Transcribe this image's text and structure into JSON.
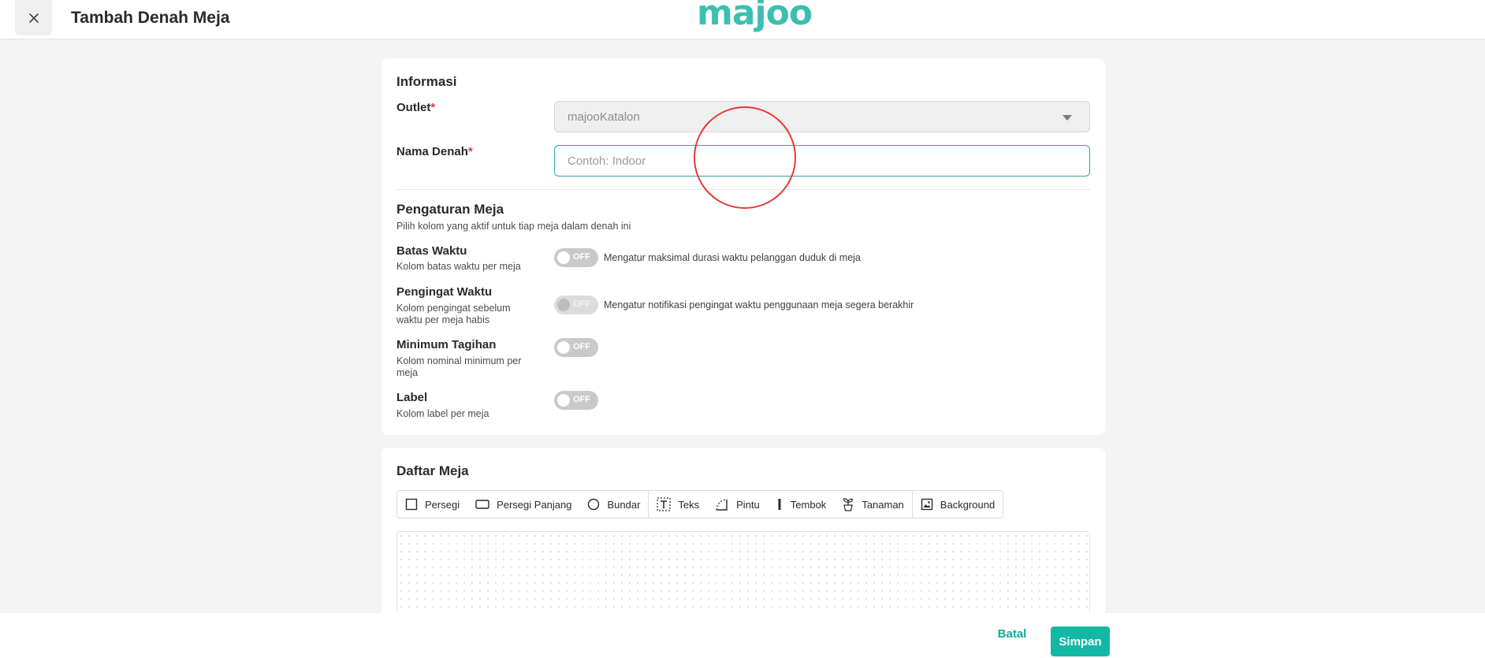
{
  "header": {
    "title": "Tambah Denah Meja",
    "logo": "majoo",
    "close_icon": "close-icon"
  },
  "informasi": {
    "title": "Informasi",
    "outlet_label": "Outlet",
    "outlet_value": "majooKatalon",
    "nama_label": "Nama Denah",
    "nama_placeholder": "Contoh: Indoor",
    "nama_value": "",
    "required_mark": "*"
  },
  "pengaturan": {
    "title": "Pengaturan Meja",
    "subtitle": "Pilih kolom yang aktif untuk tiap meja dalam denah ini",
    "rows": [
      {
        "title": "Batas Waktu",
        "desc": "Kolom batas waktu per meja",
        "toggle": "OFF",
        "toggle_desc": "Mengatur maksimal durasi waktu pelanggan duduk di meja",
        "disabled": false
      },
      {
        "title": "Pengingat Waktu",
        "desc": "Kolom pengingat sebelum waktu per meja habis",
        "toggle": "OFF",
        "toggle_desc": "Mengatur notifikasi pengingat waktu penggunaan meja segera berakhir",
        "disabled": true
      },
      {
        "title": "Minimum Tagihan",
        "desc": "Kolom nominal minimum per meja",
        "toggle": "OFF",
        "toggle_desc": "",
        "disabled": false
      },
      {
        "title": "Label",
        "desc": "Kolom label per meja",
        "toggle": "OFF",
        "toggle_desc": "",
        "disabled": false
      }
    ]
  },
  "daftar": {
    "title": "Daftar Meja",
    "tools": [
      {
        "label": "Persegi",
        "icon": "square-icon"
      },
      {
        "label": "Persegi Panjang",
        "icon": "rectangle-icon"
      },
      {
        "label": "Bundar",
        "icon": "circle-icon"
      },
      {
        "label": "Teks",
        "icon": "text-icon"
      },
      {
        "label": "Pintu",
        "icon": "door-icon"
      },
      {
        "label": "Tembok",
        "icon": "wall-icon"
      },
      {
        "label": "Tanaman",
        "icon": "plant-icon"
      },
      {
        "label": "Background",
        "icon": "image-icon"
      }
    ]
  },
  "footer": {
    "cancel_label": "Batal",
    "save_label": "Simpan"
  },
  "colors": {
    "accent": "#13b8a5",
    "required": "#e53935"
  }
}
